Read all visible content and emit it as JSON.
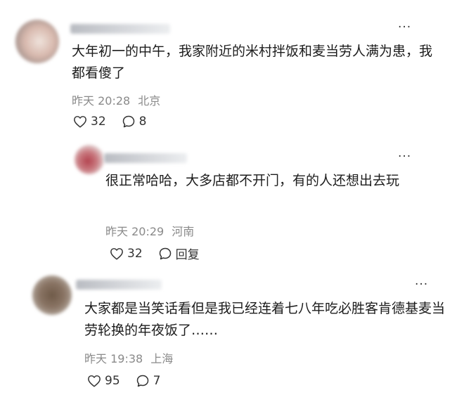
{
  "comments": [
    {
      "text": "大年初一的中午，我家附近的米村拌饭和麦当劳人满为患，我都看傻了",
      "time": "昨天 20:28",
      "location": "北京",
      "likes": "32",
      "replies": "8",
      "more": "···"
    },
    {
      "text": "很正常哈哈，大多店都不开门，有的人还想出去玩",
      "time": "昨天 20:29",
      "location": "河南",
      "likes": "32",
      "reply_label": "回复",
      "more": "···"
    },
    {
      "text": "大家都是当笑话看但是我已经连着七八年吃必胜客肯德基麦当劳轮换的年夜饭了……",
      "time": "昨天 19:38",
      "location": "上海",
      "likes": "95",
      "replies": "7",
      "more": "···"
    }
  ],
  "icons": {
    "like": "heart-icon",
    "comment": "comment-bubble-icon",
    "more": "more-dots-icon"
  }
}
